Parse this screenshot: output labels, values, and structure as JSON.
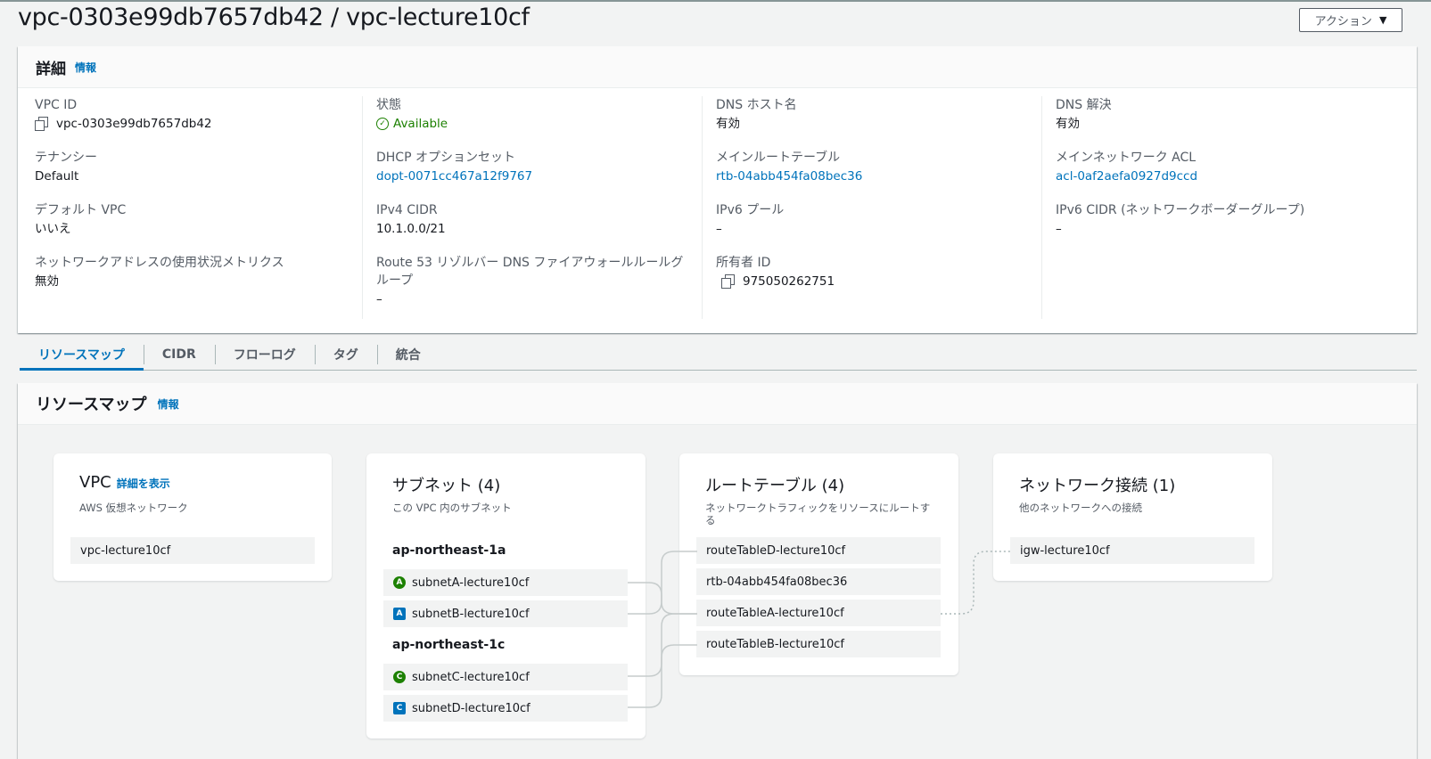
{
  "page": {
    "title": "vpc-0303e99db7657db42 / vpc-lecture10cf",
    "action_label": "アクション"
  },
  "details": {
    "heading": "詳細",
    "info_label": "情報",
    "col1": {
      "vpc_id_label": "VPC ID",
      "vpc_id_value": "vpc-0303e99db7657db42",
      "tenancy_label": "テナンシー",
      "tenancy_value": "Default",
      "default_vpc_label": "デフォルト VPC",
      "default_vpc_value": "いいえ",
      "metrics_label": "ネットワークアドレスの使用状況メトリクス",
      "metrics_value": "無効"
    },
    "col2": {
      "state_label": "状態",
      "state_value": "Available",
      "dhcp_label": "DHCP オプションセット",
      "dhcp_value": "dopt-0071cc467a12f9767",
      "ipv4_label": "IPv4 CIDR",
      "ipv4_value": "10.1.0.0/21",
      "r53_label": "Route 53 リゾルバー DNS ファイアウォールルールグループ",
      "r53_value": "–"
    },
    "col3": {
      "dns_host_label": "DNS ホスト名",
      "dns_host_value": "有効",
      "main_rt_label": "メインルートテーブル",
      "main_rt_value": "rtb-04abb454fa08bec36",
      "ipv6_pool_label": "IPv6 プール",
      "ipv6_pool_value": "–",
      "owner_label": "所有者 ID",
      "owner_value": "975050262751"
    },
    "col4": {
      "dns_res_label": "DNS 解決",
      "dns_res_value": "有効",
      "main_acl_label": "メインネットワーク ACL",
      "main_acl_value": "acl-0af2aefa0927d9ccd",
      "ipv6_cidr_label": "IPv6 CIDR (ネットワークボーダーグループ)",
      "ipv6_cidr_value": "–"
    }
  },
  "tabs": [
    {
      "label": "リソースマップ"
    },
    {
      "label": "CIDR"
    },
    {
      "label": "フローログ"
    },
    {
      "label": "タグ"
    },
    {
      "label": "統合"
    }
  ],
  "resource_map": {
    "heading": "リソースマップ",
    "info_label": "情報",
    "vpc": {
      "title": "VPC",
      "detail_link": "詳細を表示",
      "subtitle": "AWS 仮想ネットワーク",
      "item": "vpc-lecture10cf"
    },
    "subnets": {
      "title": "サブネット (4)",
      "subtitle": "この VPC 内のサブネット",
      "az1": "ap-northeast-1a",
      "az2": "ap-northeast-1c",
      "items": [
        {
          "badge": "A",
          "name": "subnetA-lecture10cf"
        },
        {
          "badge": "A",
          "name": "subnetB-lecture10cf"
        },
        {
          "badge": "C",
          "name": "subnetC-lecture10cf"
        },
        {
          "badge": "C",
          "name": "subnetD-lecture10cf"
        }
      ]
    },
    "route_tables": {
      "title": "ルートテーブル (4)",
      "subtitle": "ネットワークトラフィックをリソースにルートする",
      "items": [
        {
          "name": "routeTableD-lecture10cf"
        },
        {
          "name": "rtb-04abb454fa08bec36"
        },
        {
          "name": "routeTableA-lecture10cf"
        },
        {
          "name": "routeTableB-lecture10cf"
        }
      ]
    },
    "network": {
      "title": "ネットワーク接続 (1)",
      "subtitle": "他のネットワークへの接続",
      "item": "igw-lecture10cf"
    }
  },
  "colors": {
    "link": "#0073bb",
    "success": "#1d8102",
    "background": "#f2f3f3"
  }
}
